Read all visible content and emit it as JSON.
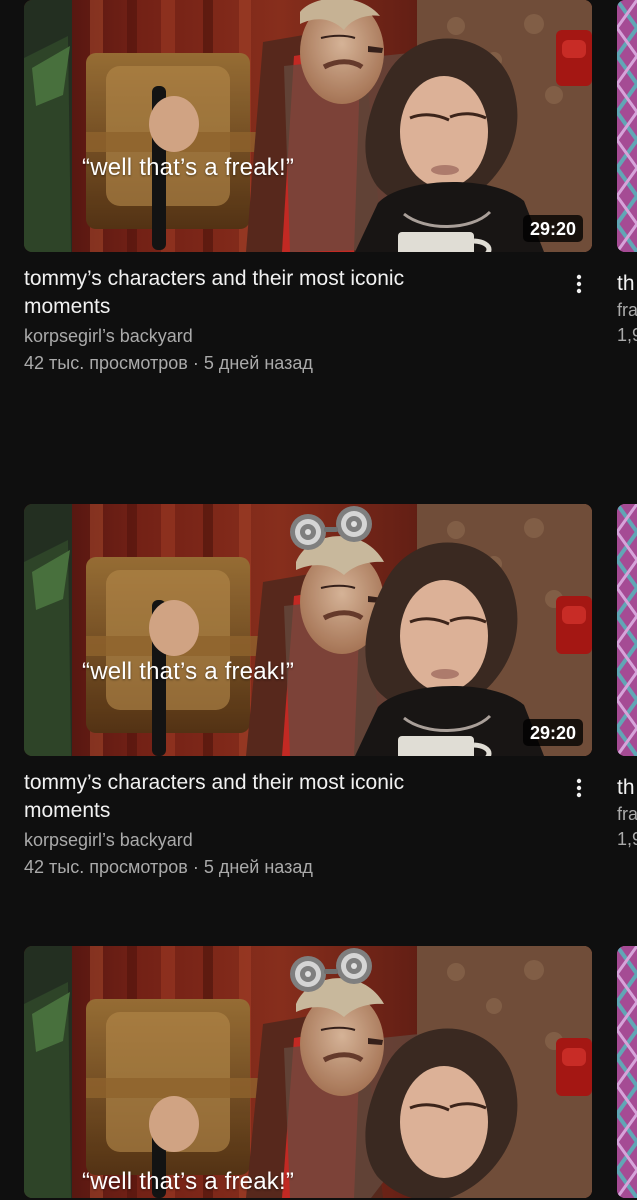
{
  "feed": {
    "videos": [
      {
        "caption": "“well that’s a freak!”",
        "duration": "29:20",
        "title": "tommy’s characters and their most iconic moments",
        "channel": "korpsegirl’s backyard",
        "views": "42 тыс. просмотров",
        "separator": "·",
        "age": "5 дней назад",
        "menu_icon": "more-vert-icon"
      },
      {
        "caption": "“well that’s a freak!”",
        "duration": "29:20",
        "title": "tommy’s characters and their most iconic moments",
        "channel": "korpsegirl’s backyard",
        "views": "42 тыс. просмотров",
        "separator": "·",
        "age": "5 дней назад",
        "menu_icon": "more-vert-icon"
      },
      {
        "caption": "“well that’s a freak!”"
      }
    ],
    "side_videos": [
      {
        "title_fragment": "th",
        "channel_fragment": "fra",
        "stats_fragment": "1,9"
      },
      {
        "title_fragment": "th",
        "channel_fragment": "fra",
        "stats_fragment": "1,9"
      },
      {}
    ]
  }
}
